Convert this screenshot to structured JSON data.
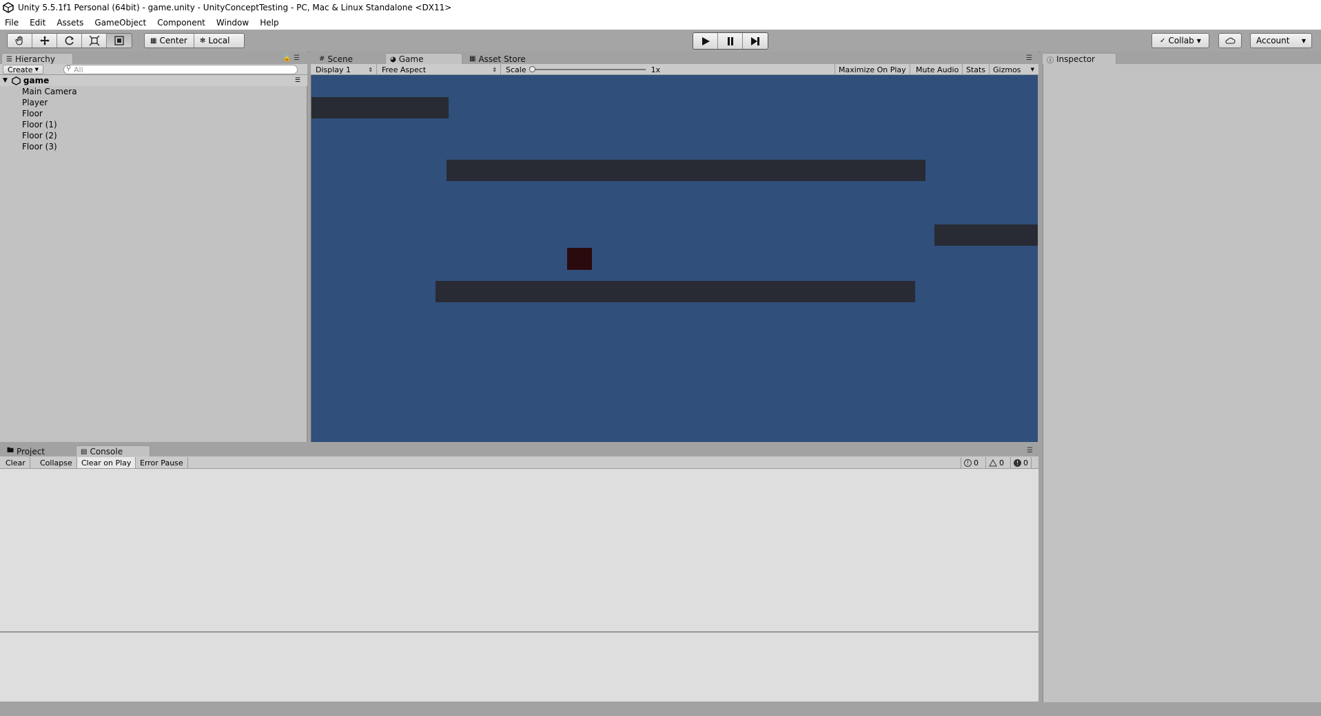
{
  "window": {
    "title": "Unity 5.5.1f1 Personal (64bit) - game.unity - UnityConceptTesting - PC, Mac & Linux Standalone <DX11>"
  },
  "menu": [
    "File",
    "Edit",
    "Assets",
    "GameObject",
    "Component",
    "Window",
    "Help"
  ],
  "toolbar": {
    "tools": [
      "hand-tool",
      "move-tool",
      "rotate-tool",
      "scale-tool",
      "rect-tool"
    ],
    "pivot_center": "Center",
    "pivot_local": "Local",
    "collab": "Collab",
    "account": "Account"
  },
  "hierarchy": {
    "tab": "Hierarchy",
    "create": "Create",
    "search_placeholder": "All",
    "scene": "game",
    "items": [
      "Main Camera",
      "Player",
      "Floor",
      "Floor (1)",
      "Floor (2)",
      "Floor (3)"
    ]
  },
  "center_tabs": {
    "scene": "Scene",
    "game": "Game",
    "asset_store": "Asset Store"
  },
  "game_toolbar": {
    "display": "Display 1",
    "aspect": "Free Aspect",
    "scale_label": "Scale",
    "scale_value": "1x",
    "maximize": "Maximize On Play",
    "mute": "Mute Audio",
    "stats": "Stats",
    "gizmos": "Gizmos"
  },
  "game_view": {
    "background": "#304f7b",
    "platform_color": "#282b34",
    "player_color": "#2a0a0c"
  },
  "inspector": {
    "tab": "Inspector"
  },
  "bottom_tabs": {
    "project": "Project",
    "console": "Console"
  },
  "console": {
    "clear": "Clear",
    "collapse": "Collapse",
    "clear_on_play": "Clear on Play",
    "error_pause": "Error Pause",
    "log_count": "0",
    "warning_count": "0",
    "error_count": "0"
  }
}
